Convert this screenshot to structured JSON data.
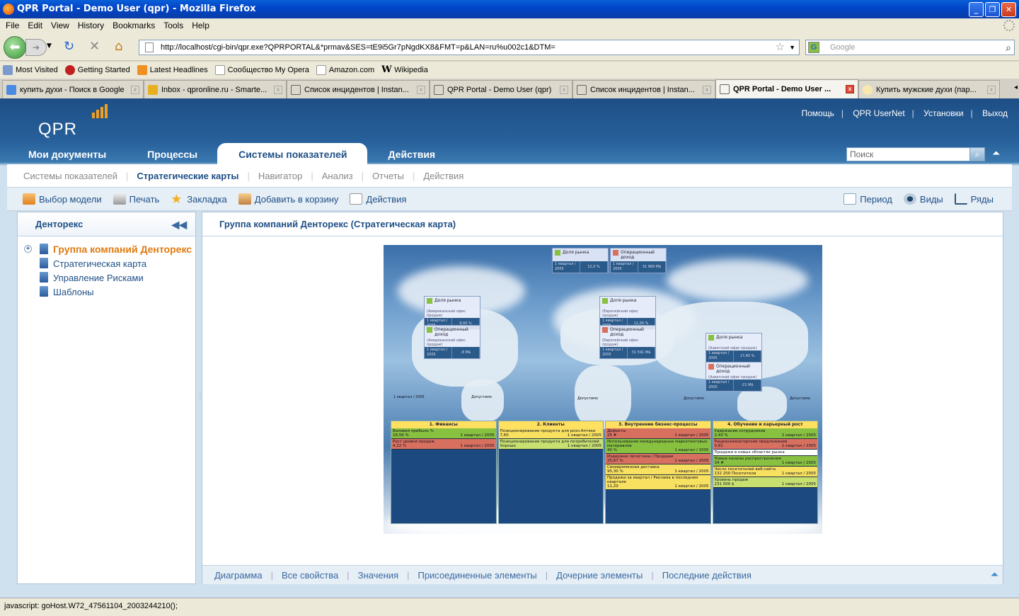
{
  "window": {
    "title": "QPR Portal - Demo User (qpr) - Mozilla Firefox"
  },
  "menu": [
    "File",
    "Edit",
    "View",
    "History",
    "Bookmarks",
    "Tools",
    "Help"
  ],
  "nav": {
    "url": "http://localhost/cgi-bin/qpr.exe?QPRPORTAL&*prmav&SES=tE9i5Gr7pNgdKX8&FMT=p&LAN=ru%u002c1&DTM=",
    "search_placeholder": "Google"
  },
  "bookmarks": [
    "Most Visited",
    "Getting Started",
    "Latest Headlines",
    "Сообщество My Opera",
    "Amazon.com",
    "Wikipedia"
  ],
  "tabs": [
    {
      "label": "купить духи - Поиск в Google",
      "active": false
    },
    {
      "label": "Inbox - qpronline.ru - Smarte...",
      "active": false
    },
    {
      "label": "Список инцидентов | Instan...",
      "active": false
    },
    {
      "label": "QPR Portal - Demo User (qpr)",
      "active": false
    },
    {
      "label": "Список инцидентов | Instan...",
      "active": false
    },
    {
      "label": "QPR Portal - Demo User ...",
      "active": true
    },
    {
      "label": "Купить мужские духи (пар...",
      "active": false
    }
  ],
  "app": {
    "logo": "QPR",
    "toplinks": [
      "Помощь",
      "QPR UserNet",
      "Установки",
      "Выход"
    ],
    "maintabs": [
      "Мои документы",
      "Процессы",
      "Системы показателей",
      "Действия"
    ],
    "search_placeholder": "Поиск",
    "subnav": [
      "Системы показателей",
      "Стратегические карты",
      "Навигатор",
      "Анализ",
      "Отчеты",
      "Действия"
    ],
    "toolbar_left": [
      "Выбор модели",
      "Печать",
      "Закладка",
      "Добавить в корзину",
      "Действия"
    ],
    "toolbar_right": [
      "Период",
      "Виды",
      "Ряды"
    ],
    "left_panel": {
      "title": "Денторекс",
      "items": [
        "Группа компаний Денторекс",
        "Стратегическая карта",
        "Управление Рисками",
        "Шаблоны"
      ]
    },
    "main_panel": {
      "title": "Группа компаний Денторекс (Стратегическая карта)"
    },
    "map": {
      "kpis": [
        {
          "name": "Доля рынка",
          "sub": "",
          "period": "1 квартал / 2005",
          "value": "12,0 %",
          "color": "#88c040"
        },
        {
          "name": "Операционный доход",
          "sub": "",
          "period": "1 квартал / 2005",
          "value": "31 969 М$",
          "color": "#d87060"
        },
        {
          "name": "Доля рынка",
          "sub": "(Американский офис продаж)",
          "period": "1 квартал / 2005",
          "value": "9,00 %",
          "color": "#88c040"
        },
        {
          "name": "Операционный доход",
          "sub": "(Американский офис продаж)",
          "period": "1 квартал / 2005",
          "value": "-8 М$",
          "color": "#88c040"
        },
        {
          "name": "Доля рынка",
          "sub": "(Европейский офис продаж)",
          "period": "1 квартал / 2005",
          "value": "11,00 %",
          "color": "#88c040"
        },
        {
          "name": "Операционный доход",
          "sub": "(Европейский офис продаж)",
          "period": "1 квартал / 2005",
          "value": "31 591 М$",
          "color": "#d87060"
        },
        {
          "name": "Доля рынка",
          "sub": "(Азиатский офис продаж)",
          "period": "1 квартал / 2005",
          "value": "17,40 %",
          "color": "#88c040"
        },
        {
          "name": "Операционный доход",
          "sub": "(Азиатский офис продаж)",
          "period": "1 квартал / 2005",
          "value": "-21 М$",
          "color": "#d87060"
        }
      ],
      "labels": [
        "1 квартал / 2005",
        "Допустимо",
        "Допустимо",
        "Допустимо",
        "Допустимо",
        "Допустимо"
      ],
      "columns": [
        {
          "title": "1. Финансы",
          "cells": [
            {
              "name": "Валовая прибыль %",
              "value": "16,56 %",
              "period": "1 квартал / 2005",
              "color": "g"
            },
            {
              "name": "Рост уровня продаж",
              "value": "4,22 %",
              "period": "1 квартал / 2005",
              "color": "rr"
            }
          ]
        },
        {
          "title": "2. Клиенты",
          "cells": [
            {
              "name": "Позиционирование продукта для розн.Аптеки",
              "value": "7,60",
              "period": "1 квартал / 2005",
              "color": "y"
            },
            {
              "name": "Позиционирование продукта для потребителей",
              "value": "Хорошо",
              "period": "1 квартал / 2005",
              "color": "lg"
            }
          ]
        },
        {
          "title": "3. Внутренние бизнес-процессы",
          "cells": [
            {
              "name": "Дефекты",
              "value": "25 #",
              "period": "1 квартал / 2005",
              "color": "rr"
            },
            {
              "name": "Использование международных маркетинговых материалов",
              "value": "40 %",
              "period": "1 квартал / 2005",
              "color": "g"
            },
            {
              "name": "Издержки логистики / Продажи",
              "value": "25,67 %",
              "period": "1 квартал / 2005",
              "color": "rr"
            },
            {
              "name": "Своевременная доставка",
              "value": "95,30 %",
              "period": "1 квартал / 2005",
              "color": "y"
            },
            {
              "name": "Продажи за квартал / Реклама в последнем квартале",
              "value": "11,20",
              "period": "1 квартал / 2005",
              "color": "y"
            }
          ]
        },
        {
          "title": "4. Обучение и карьерный рост",
          "cells": [
            {
              "name": "Удержание сотрудников",
              "value": "2,43 %",
              "period": "1 квартал / 2005",
              "color": "g"
            },
            {
              "name": "Рационализаторские предложения",
              "value": "0,81",
              "period": "1 квартал / 2005",
              "color": "rr"
            },
            {
              "name": "Продажи в новых областях рынка",
              "value": "",
              "period": "",
              "color": "w"
            },
            {
              "name": "Новые каналы распространения",
              "value": "34 #",
              "period": "1 квартал / 2005",
              "color": "g"
            },
            {
              "name": "Число посетителей веб-сайта",
              "value": "132 200 Посетители",
              "period": "1 квартал / 2005",
              "color": "y"
            },
            {
              "name": "Уровень продаж",
              "value": "231 000 $",
              "period": "1 квартал / 2005",
              "color": "lg"
            }
          ]
        }
      ]
    },
    "bottom_tabs": [
      "Диаграмма",
      "Все свойства",
      "Значения",
      "Присоединенные элементы",
      "Дочерние элементы",
      "Последние действия"
    ]
  },
  "status": "javascript: goHost.W72_47561104_2003244210();"
}
